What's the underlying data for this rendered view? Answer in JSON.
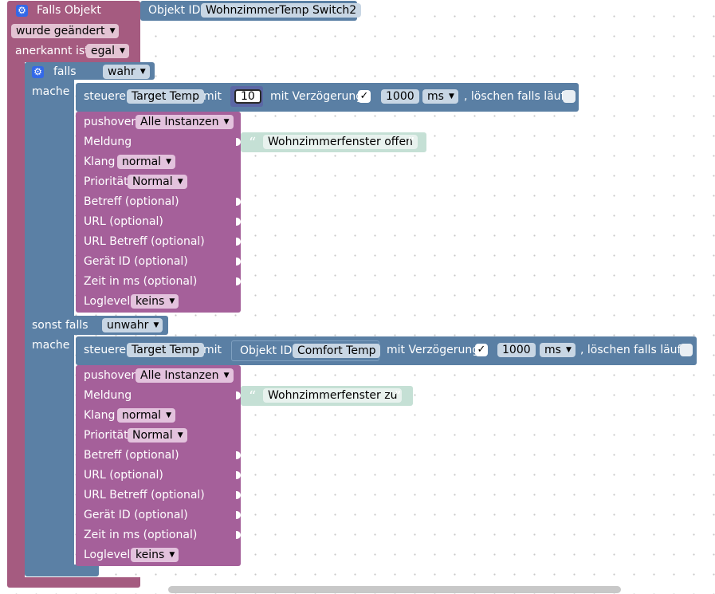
{
  "trigger": {
    "title": "Falls Objekt",
    "object_id_label": "Objekt ID",
    "object_id_value": "WohnzimmerTemp  Switch2",
    "changed_value": "wurde geändert",
    "ack_label": "anerkannt ist",
    "ack_value": "egal"
  },
  "if_block": {
    "if_label": "falls",
    "if_value": "wahr",
    "do_label": "mache",
    "else_label": "sonst falls",
    "else_value": "unwahr",
    "do2_label": "mache"
  },
  "control1": {
    "steuere": "steuere",
    "target": "Target Temp",
    "mit": "mit",
    "value": "10",
    "delay_label": "mit Verzögerung",
    "check": "✓",
    "delay_value": "1000",
    "unit": "ms",
    "clear_label": ", löschen falls läuft"
  },
  "pushover1": {
    "label": "pushover",
    "instance": "Alle Instanzen",
    "message_label": "Meldung",
    "message": "Wohnzimmerfenster offen",
    "sound_label": "Klang",
    "sound": "normal",
    "priority_label": "Priorität",
    "priority": "Normal",
    "subject": "Betreff (optional)",
    "url": "URL (optional)",
    "url_title": "URL Betreff (optional)",
    "device": "Gerät ID (optional)",
    "time": "Zeit in ms (optional)",
    "loglevel_label": "Loglevel",
    "loglevel": "keins"
  },
  "control2": {
    "steuere": "steuere",
    "target": "Target Temp",
    "mit": "mit",
    "obj_label": "Objekt ID",
    "obj_value": "Comfort Temp",
    "delay_label": "mit Verzögerung",
    "check": "✓",
    "delay_value": "1000",
    "unit": "ms",
    "clear_label": ", löschen falls läuft"
  },
  "pushover2": {
    "label": "pushover",
    "instance": "Alle Instanzen",
    "message_label": "Meldung",
    "message": "Wohnzimmerfenster zu",
    "sound_label": "Klang",
    "sound": "normal",
    "priority_label": "Priorität",
    "priority": "Normal",
    "subject": "Betreff (optional)",
    "url": "URL (optional)",
    "url_title": "URL Betreff (optional)",
    "device": "Gerät ID (optional)",
    "time": "Zeit in ms (optional)",
    "loglevel_label": "Loglevel",
    "loglevel": "keins"
  },
  "icons": {
    "gear": "gear-icon",
    "dropdown": "dropdown-arrow-icon",
    "quote_open": "quote-open-icon",
    "quote_close": "quote-close-icon"
  },
  "colors": {
    "trigger_block": "#a55b80",
    "logic_block": "#5b80a5",
    "pushover_block": "#a5609a",
    "text_block": "#c5e0d5"
  }
}
